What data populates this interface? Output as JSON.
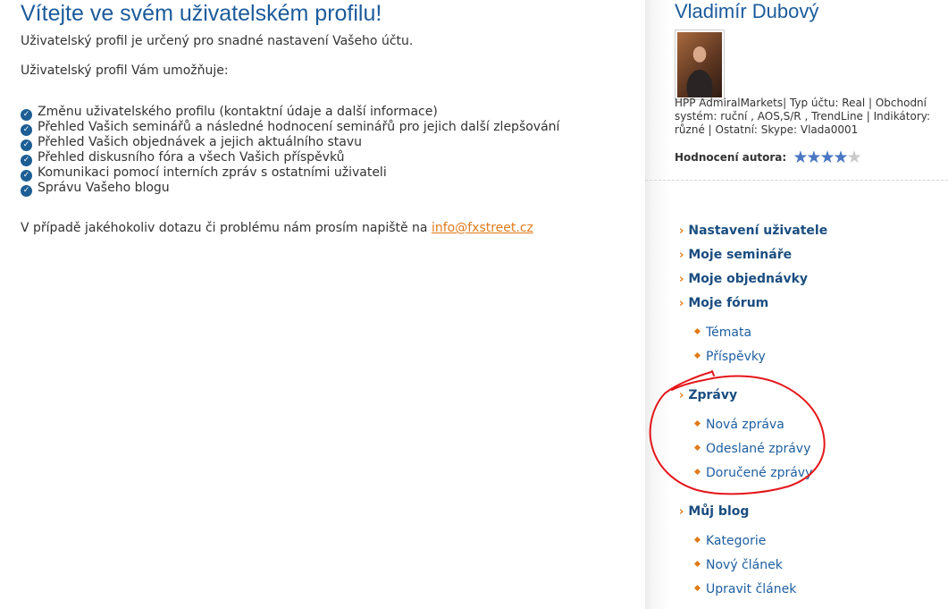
{
  "main": {
    "title": "Vítejte ve svém uživatelském profilu!",
    "intro": "Uživatelský profil je určený pro snadné nastavení Vašeho účtu.",
    "features_heading": "Uživatelský profil Vám umožňuje:",
    "features": [
      "Změnu uživatelského profilu (kontaktní údaje a další informace)",
      "Přehled Vašich seminářů a následné hodnocení seminářů pro jejich další zlepšování",
      "Přehled Vašich objednávek a jejich aktuálního stavu",
      "Přehled diskusního fóra a všech Vašich příspěvků",
      "Komunikaci pomocí interních zpráv s ostatními uživateli",
      "Správu Vašeho blogu"
    ],
    "contact_text": "V případě jakéhokoliv dotazu či problému nám prosím napiště na ",
    "contact_email": "info@fxstreet.cz"
  },
  "sidebar": {
    "author_name": "Vladimír Dubový",
    "author_info": "HPP AdmiralMarkets| Typ účtu: Real | Obchodní systém: ruční , AOS,S/R , TrendLine | Indikátory: různé | Ostatní: Skype: Vlada0001",
    "rating_label": "Hodnocení autora:",
    "rating": {
      "value": 4,
      "max": 5
    },
    "nav": {
      "settings": "Nastavení uživatele",
      "seminars": "Moje semináře",
      "orders": "Moje objednávky",
      "forum": "Moje fórum",
      "forum_topics": "Témata",
      "forum_posts": "Příspěvky",
      "messages": "Zprávy",
      "messages_new": "Nová zpráva",
      "messages_sent": "Odeslané zprávy",
      "messages_received": "Doručené zprávy",
      "blog": "Můj blog",
      "blog_categories": "Kategorie",
      "blog_new_article": "Nový článek",
      "blog_edit_article": "Upravit článek"
    }
  },
  "colors": {
    "title_blue": "#1b5b9b",
    "nav_blue": "#1a4d80",
    "accent_orange": "#e07a1a",
    "annotation_red": "#e4161b",
    "star_blue": "#4a76c3"
  },
  "icons": {
    "feature_bullet": "check-circle-icon",
    "nav_bullet": "chevron-right-icon",
    "sub_bullet": "diamond-bullet-icon",
    "rating": "star-icon"
  }
}
